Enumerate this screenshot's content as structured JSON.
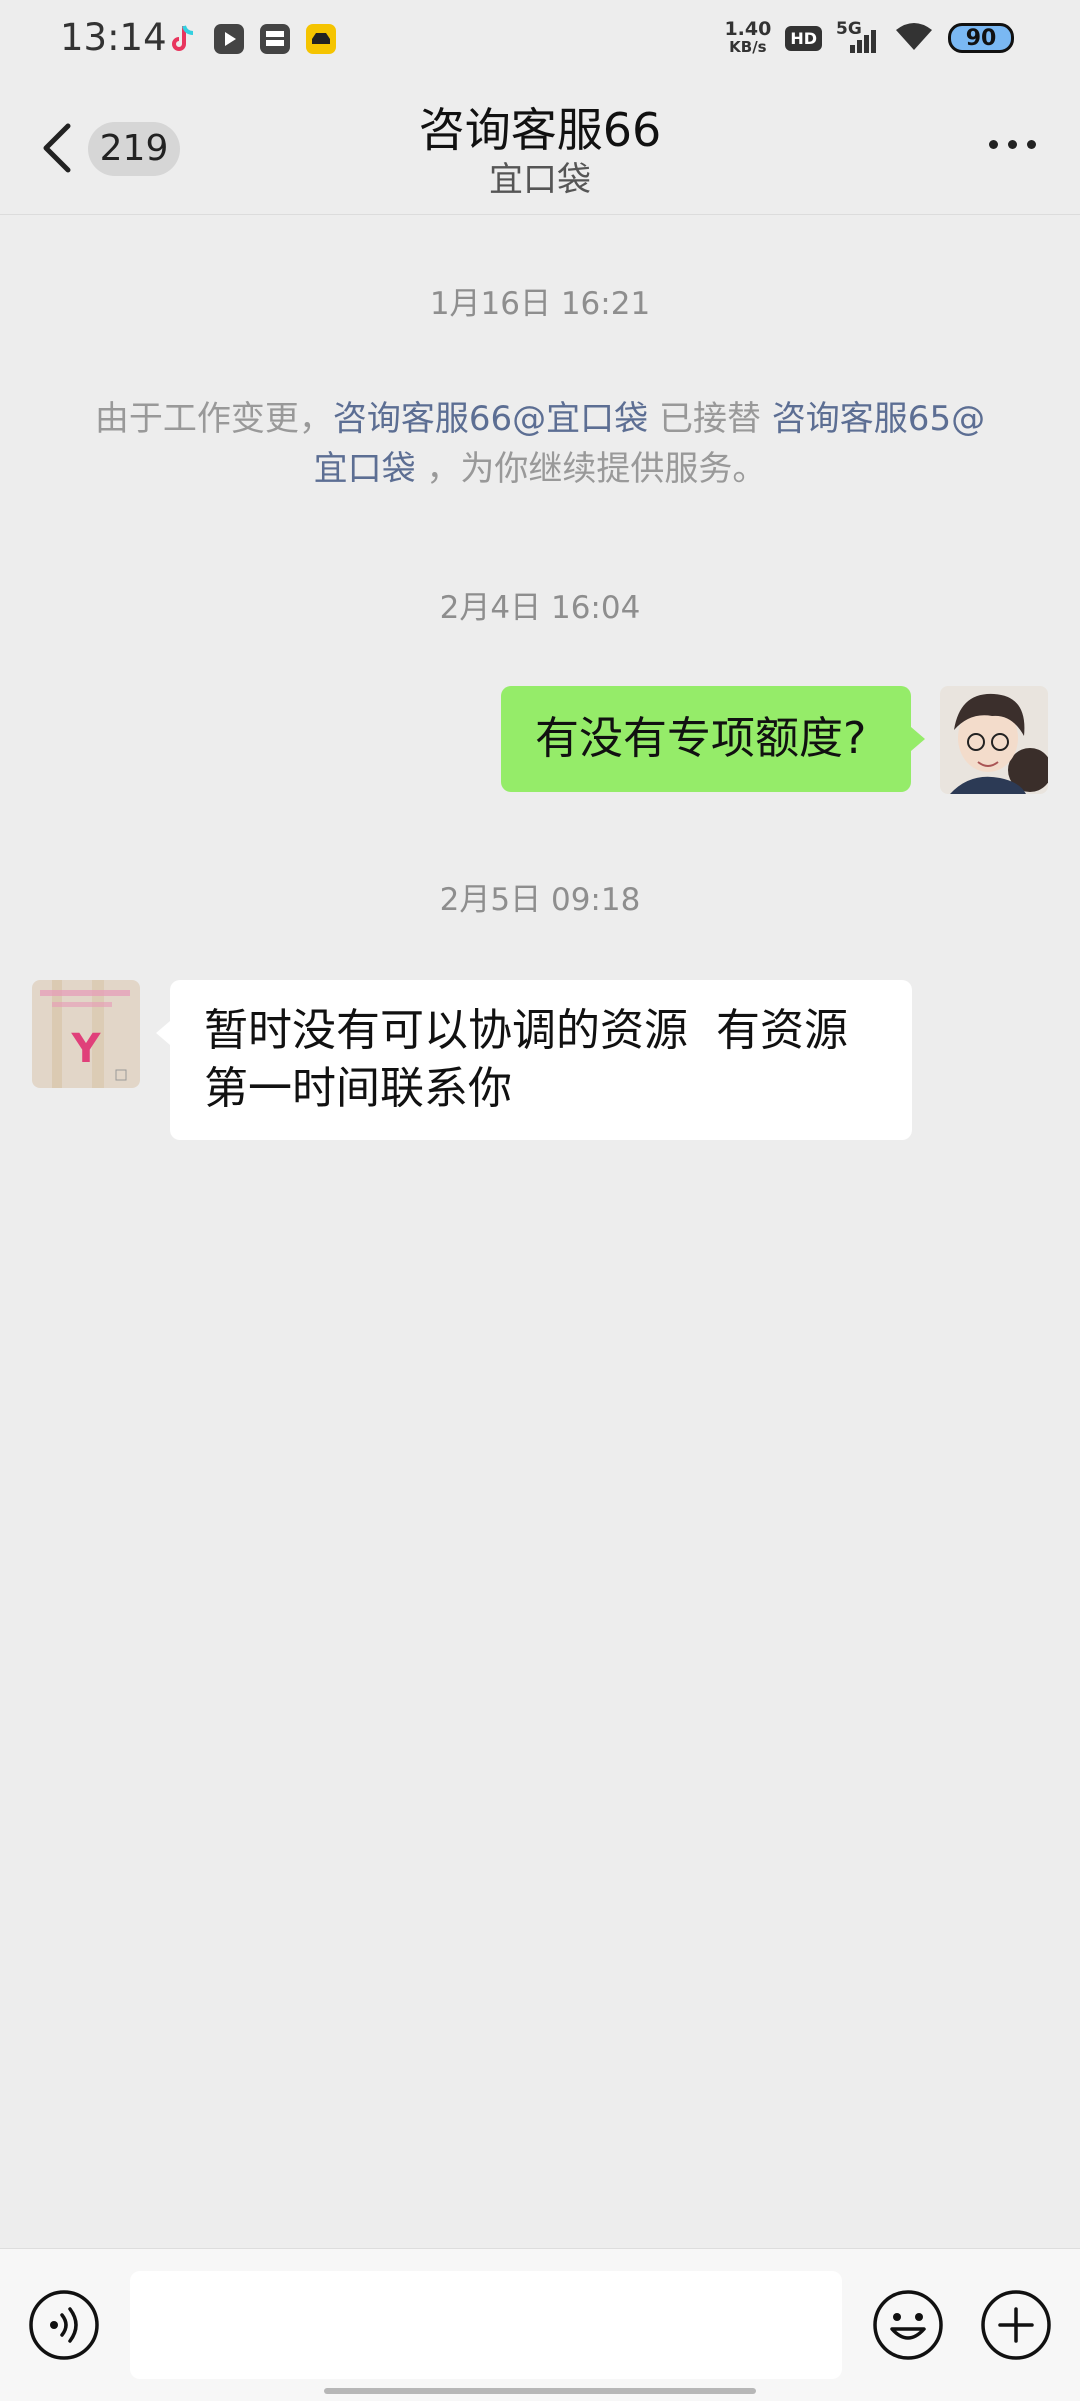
{
  "status_bar": {
    "time": "13:14",
    "apps": [
      "tiktok-icon",
      "video-app-icon",
      "bus-app-icon",
      "car-app-icon"
    ],
    "net_speed_value": "1.40",
    "net_speed_unit": "KB/s",
    "hd": "HD",
    "network": "5G",
    "battery": "90"
  },
  "header": {
    "unread_count": "219",
    "title": "咨询客服66",
    "subtitle": "宜口袋"
  },
  "messages": {
    "ts1": "1月16日 16:21",
    "system": {
      "part1": "由于工作变更，",
      "link1": "咨询客服66@宜口袋",
      "part2": " 已接替 ",
      "link2": "咨询客服65@宜口袋",
      "part3": " ，为你继续提供服务。"
    },
    "ts2": "2月4日 16:04",
    "outgoing_text": "有没有专项额度?",
    "ts3": "2月5日 09:18",
    "incoming_text": "暂时没有可以协调的资源  有资源第一时间联系你",
    "incoming_avatar_letter": "Y"
  },
  "colors": {
    "outgoing_bubble": "#95ec69",
    "incoming_bubble": "#ffffff",
    "link": "#5c6e93",
    "background": "#ededed"
  }
}
